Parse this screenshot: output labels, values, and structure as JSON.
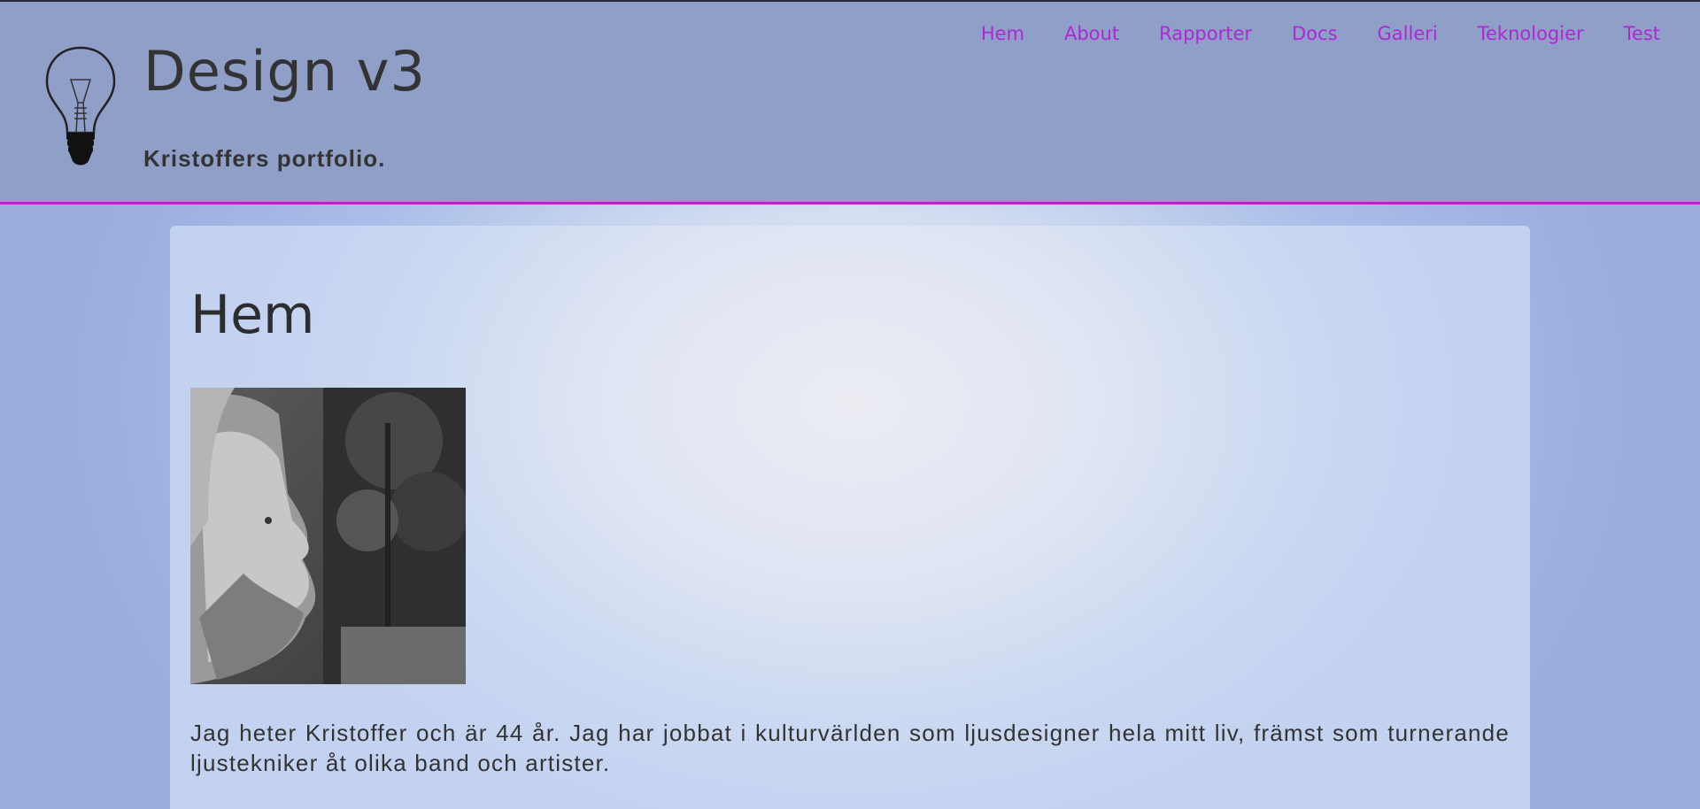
{
  "site": {
    "title": "Design v3",
    "subtitle": "Kristoffers portfolio.",
    "logo_icon": "lightbulb-icon"
  },
  "nav": {
    "items": [
      "Hem",
      "About",
      "Rapporter",
      "Docs",
      "Galleri",
      "Teknologier",
      "Test"
    ]
  },
  "main": {
    "heading": "Hem",
    "portrait_icon": "portrait-photo",
    "bio": "Jag heter Kristoffer och är 44 år. Jag har jobbat i kulturvärlden som ljusdesigner hela mitt liv, främst som turnerande ljustekniker åt olika band och artister."
  },
  "colors": {
    "accent": "#b026d6",
    "header_bg": "#8f9fc8",
    "text": "#333333"
  }
}
